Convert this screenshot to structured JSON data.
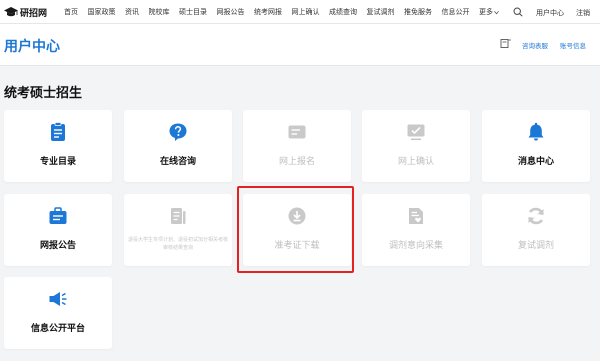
{
  "colors": {
    "accent": "#1d77d6",
    "active_icon": "#1d77d6",
    "disabled_icon": "#c9c9c9",
    "highlight": "#e52222"
  },
  "topnav": {
    "logo_text": "研招网",
    "items": [
      "首页",
      "国家政策",
      "资讯",
      "院校库",
      "硕士目录",
      "网报公告",
      "统考网报",
      "网上确认",
      "成绩查询",
      "复试调剂",
      "推免服务",
      "信息公开"
    ],
    "more_label": "更多",
    "user_center": "用户中心",
    "logout": "注销"
  },
  "header": {
    "title": "用户中心",
    "links": [
      "咨询表服",
      "账号信息"
    ]
  },
  "section_title": "统考硕士招生",
  "cards": [
    {
      "label": "专业目录",
      "icon": "document-list-icon",
      "enabled": true
    },
    {
      "label": "在线咨询",
      "icon": "chat-question-icon",
      "enabled": true
    },
    {
      "label": "网上报名",
      "icon": "id-card-icon",
      "enabled": false
    },
    {
      "label": "网上确认",
      "icon": "check-screen-icon",
      "enabled": false
    },
    {
      "label": "消息中心",
      "icon": "bell-icon",
      "enabled": true
    },
    {
      "label": "网报公告",
      "icon": "briefcase-notice-icon",
      "enabled": true
    },
    {
      "label": "",
      "icon": "document-icon",
      "enabled": false,
      "note": "退役大学生专项计划、退役初试加分相关考核审核结果查询"
    },
    {
      "label": "准考证下载",
      "icon": "download-circle-icon",
      "enabled": false
    },
    {
      "label": "调剂意向采集",
      "icon": "document-heart-icon",
      "enabled": false
    },
    {
      "label": "复试调剂",
      "icon": "refresh-icon",
      "enabled": false
    },
    {
      "label": "信息公开平台",
      "icon": "speaker-icon",
      "enabled": true
    }
  ]
}
